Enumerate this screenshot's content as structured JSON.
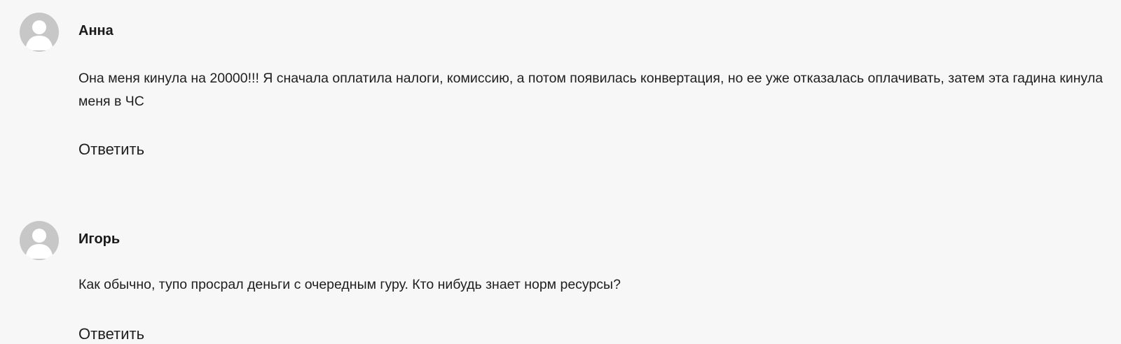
{
  "comments": [
    {
      "author": "Анна",
      "avatar_icon": "user-silhouette-icon",
      "text": "Она меня кинула на 20000!!! Я сначала оплатила налоги, комиссию, а потом появилась конвертация, но ее уже отказалась оплачивать, затем эта гадина кинула меня в ЧС",
      "reply_label": "Ответить"
    },
    {
      "author": "Игорь",
      "avatar_icon": "user-silhouette-icon",
      "text": "Как обычно, тупо просрал деньги с очередным гуру. Кто нибудь знает норм ресурсы?",
      "reply_label": "Ответить"
    }
  ],
  "colors": {
    "background": "#f7f7f7",
    "avatar_bg": "#c7c7c7",
    "avatar_fg": "#ffffff",
    "text": "#1e1e1e"
  }
}
